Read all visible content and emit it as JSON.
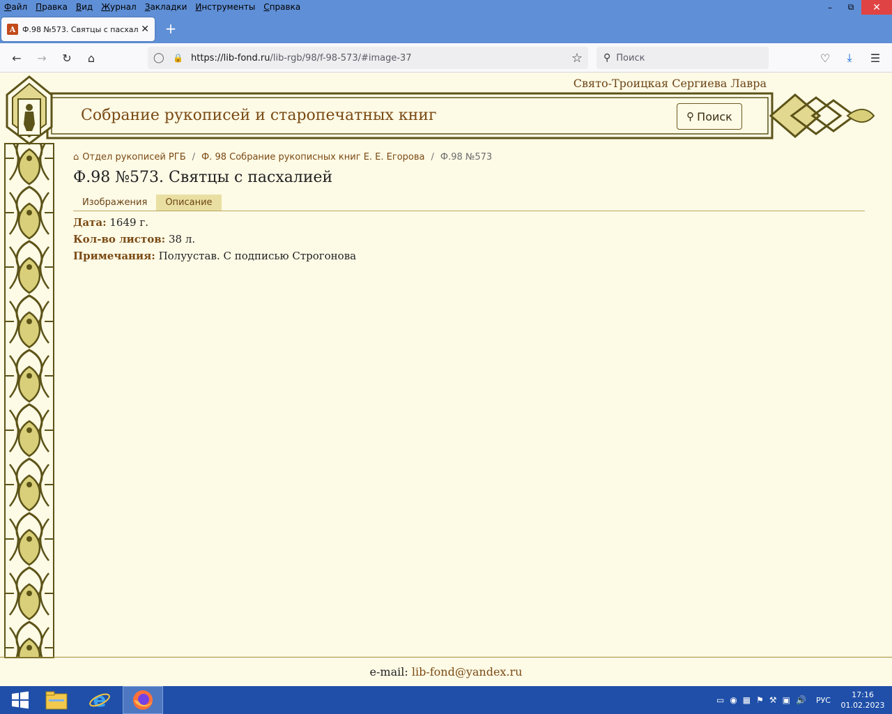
{
  "menu": [
    "Файл",
    "Правка",
    "Вид",
    "Журнал",
    "Закладки",
    "Инструменты",
    "Справка"
  ],
  "tab": {
    "title": "Ф.98 №573. Святцы с пасхалией"
  },
  "nav": {
    "url_host": "https://lib-fond.ru",
    "url_path": "/lib-rgb/98/f-98-573/#image-37",
    "search_placeholder": "Поиск"
  },
  "site": {
    "lavra": "Свято-Троицкая Сергиева Лавра",
    "title": "Собрание рукописей и старопечатных книг",
    "search_label": "Поиск"
  },
  "breadcrumb": [
    {
      "label": "Отдел рукописей РГБ"
    },
    {
      "label": "Ф. 98 Собрание рукописных книг Е. Е. Егорова"
    },
    {
      "label": "Ф.98 №573"
    }
  ],
  "page_title": "Ф.98 №573. Святцы с пасхалией",
  "tabs": [
    {
      "label": "Изображения"
    },
    {
      "label": "Описание"
    }
  ],
  "fields": [
    {
      "label": "Дата:",
      "value": "1649 г."
    },
    {
      "label": "Кол-во листов:",
      "value": "38 л."
    },
    {
      "label": "Примечания:",
      "value": "Полуустав. С подписью Строгонова"
    }
  ],
  "footer": {
    "email_label": "e-mail:",
    "email": "lib-fond@yandex.ru"
  },
  "taskbar": {
    "lang": "РУС",
    "time": "17:16",
    "date": "01.02.2023"
  }
}
